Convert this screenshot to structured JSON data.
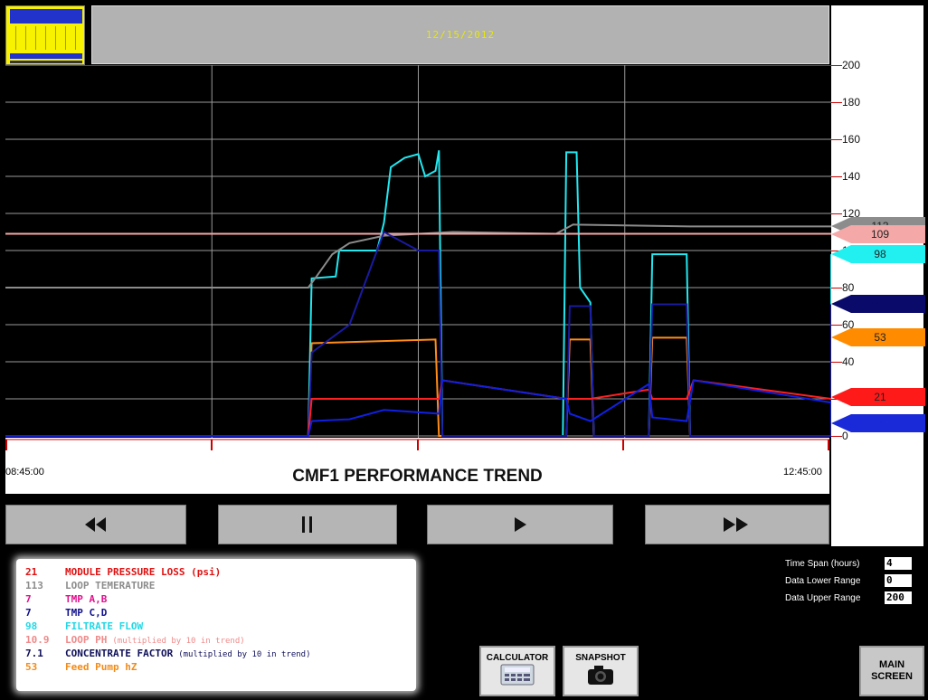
{
  "header": {
    "date": "12/15/2012"
  },
  "chart": {
    "title": "CMF1 PERFORMANCE TREND",
    "time_start": "08:45:00",
    "time_end": "12:45:00",
    "ticks": [
      "200",
      "180",
      "160",
      "140",
      "120",
      "100",
      "80",
      "60",
      "40",
      "20",
      "0"
    ]
  },
  "markers": [
    {
      "label": "113",
      "color": "#8c8c8c",
      "text_color": "#222",
      "value": 113
    },
    {
      "label": "109",
      "color": "#f4a8a8",
      "text_color": "#222",
      "value": 109
    },
    {
      "label": "98",
      "color": "#22f0f0",
      "text_color": "#222",
      "value": 98
    },
    {
      "label": "71",
      "color": "#0a0a6a",
      "text_color": "#0a0a6a",
      "value": 71
    },
    {
      "label": "53",
      "color": "#ff8c00",
      "text_color": "#222",
      "value": 53
    },
    {
      "label": "21",
      "color": "#ff1a1a",
      "text_color": "#222",
      "value": 21
    },
    {
      "label": "7",
      "color": "#1a2ad8",
      "text_color": "#1a2ad8",
      "value": 7
    }
  ],
  "nav": {
    "rewind_icon": "fast-rewind-icon",
    "pause_icon": "pause-icon",
    "play_icon": "play-icon",
    "fast_forward_icon": "fast-forward-icon"
  },
  "legend": [
    {
      "value": "21",
      "label": "MODULE PRESSURE LOSS (psi)",
      "note": "",
      "color": "#e01010"
    },
    {
      "value": "113",
      "label": "LOOP TEMERATURE",
      "note": "",
      "color": "#8c8c8c"
    },
    {
      "value": "7",
      "label": "TMP A,B",
      "note": "",
      "color": "#e0108c"
    },
    {
      "value": "7",
      "label": "TMP C,D",
      "note": "",
      "color": "#10108c"
    },
    {
      "value": "98",
      "label": "FILTRATE FLOW",
      "note": "",
      "color": "#22d8e6"
    },
    {
      "value": "10.9",
      "label": "LOOP PH",
      "note": "(multiplied by 10 in trend)",
      "color": "#f08a8a"
    },
    {
      "value": "7.1",
      "label": "CONCENTRATE FACTOR",
      "note": "(multiplied by 10 in trend)",
      "color": "#10105a"
    },
    {
      "value": "53",
      "label": "Feed Pump hZ",
      "note": "",
      "color": "#f08c1a"
    }
  ],
  "settings": {
    "time_span_label": "Time Span (hours)",
    "time_span_value": "4",
    "lower_label": "Data Lower Range",
    "lower_value": "0",
    "upper_label": "Data Upper Range",
    "upper_value": "200"
  },
  "buttons": {
    "calculator": "CALCULATOR",
    "snapshot": "SNAPSHOT",
    "main_screen_line1": "MAIN",
    "main_screen_line2": "SCREEN"
  },
  "chart_data": {
    "type": "line",
    "x_range": [
      "08:45:00",
      "12:45:00"
    ],
    "ylim": [
      0,
      200
    ],
    "x_units": "minutes from start",
    "series": [
      {
        "name": "FILTRATE FLOW",
        "color": "#22e8f0",
        "points": [
          [
            0,
            0
          ],
          [
            88,
            0
          ],
          [
            89,
            85
          ],
          [
            96,
            86
          ],
          [
            97,
            100
          ],
          [
            108,
            100
          ],
          [
            110,
            115
          ],
          [
            112,
            145
          ],
          [
            116,
            150
          ],
          [
            120,
            152
          ],
          [
            122,
            140
          ],
          [
            125,
            143
          ],
          [
            126,
            154
          ],
          [
            127,
            0
          ],
          [
            162,
            0
          ],
          [
            163,
            153
          ],
          [
            166,
            153
          ],
          [
            167,
            80
          ],
          [
            170,
            72
          ],
          [
            171,
            0
          ],
          [
            187,
            0
          ],
          [
            188,
            98
          ],
          [
            198,
            98
          ],
          [
            199,
            0
          ],
          [
            240,
            0
          ],
          [
            240,
            98
          ]
        ]
      },
      {
        "name": "LOOP TEMERATURE",
        "color": "#8c8c8c",
        "points": [
          [
            0,
            80
          ],
          [
            88,
            80
          ],
          [
            90,
            85
          ],
          [
            95,
            98
          ],
          [
            100,
            104
          ],
          [
            110,
            108
          ],
          [
            130,
            110
          ],
          [
            160,
            109
          ],
          [
            165,
            114
          ],
          [
            200,
            113
          ],
          [
            240,
            113
          ]
        ]
      },
      {
        "name": "LOOP PH",
        "color": "#f4a8a8",
        "points": [
          [
            0,
            109
          ],
          [
            120,
            109
          ],
          [
            240,
            109
          ]
        ]
      },
      {
        "name": "Feed Pump hZ",
        "color": "#ff8c1a",
        "points": [
          [
            0,
            0
          ],
          [
            88,
            0
          ],
          [
            89,
            50
          ],
          [
            125,
            52
          ],
          [
            126,
            0
          ],
          [
            163,
            0
          ],
          [
            164,
            52
          ],
          [
            170,
            52
          ],
          [
            171,
            0
          ],
          [
            187,
            0
          ],
          [
            188,
            53
          ],
          [
            198,
            53
          ],
          [
            199,
            0
          ],
          [
            240,
            0
          ],
          [
            240,
            53
          ]
        ]
      },
      {
        "name": "CONCENTRATE FACTOR",
        "color": "#1a1aa0",
        "points": [
          [
            0,
            0
          ],
          [
            88,
            0
          ],
          [
            89,
            45
          ],
          [
            100,
            60
          ],
          [
            110,
            110
          ],
          [
            120,
            100
          ],
          [
            126,
            100
          ],
          [
            127,
            0
          ],
          [
            163,
            0
          ],
          [
            164,
            70
          ],
          [
            170,
            70
          ],
          [
            171,
            0
          ],
          [
            187,
            0
          ],
          [
            188,
            71
          ],
          [
            198,
            71
          ],
          [
            199,
            0
          ],
          [
            240,
            0
          ],
          [
            240,
            71
          ]
        ]
      },
      {
        "name": "MODULE PRESSURE LOSS (psi)",
        "color": "#ff2020",
        "points": [
          [
            0,
            0
          ],
          [
            88,
            0
          ],
          [
            89,
            20
          ],
          [
            126,
            20
          ],
          [
            127,
            30
          ],
          [
            163,
            20
          ],
          [
            164,
            20
          ],
          [
            170,
            20
          ],
          [
            187,
            25
          ],
          [
            188,
            20
          ],
          [
            198,
            20
          ],
          [
            200,
            30
          ],
          [
            240,
            20
          ]
        ]
      },
      {
        "name": "TMP C,D",
        "color": "#1020e0",
        "points": [
          [
            0,
            0
          ],
          [
            88,
            0
          ],
          [
            89,
            8
          ],
          [
            100,
            9
          ],
          [
            110,
            14
          ],
          [
            126,
            12
          ],
          [
            127,
            30
          ],
          [
            163,
            20
          ],
          [
            164,
            12
          ],
          [
            170,
            8
          ],
          [
            187,
            28
          ],
          [
            188,
            10
          ],
          [
            198,
            8
          ],
          [
            200,
            30
          ],
          [
            240,
            18
          ],
          [
            240,
            7
          ]
        ]
      }
    ]
  }
}
